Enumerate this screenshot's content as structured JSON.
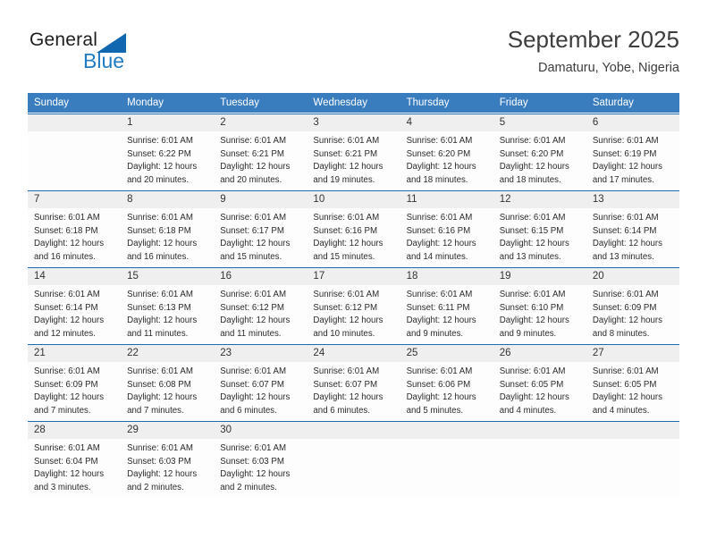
{
  "brand": {
    "name_part1": "General",
    "name_part2": "Blue",
    "triangle_color": "#1168b0",
    "blue_color": "#1f7cc4"
  },
  "header": {
    "title": "September 2025",
    "subtitle": "Damaturu, Yobe, Nigeria"
  },
  "theme": {
    "header_row_bg": "#3a7dbf",
    "date_band_bg": "#efefef",
    "week_rule": "#1e6cb0",
    "cell_bg": "#fdfdfd"
  },
  "calendar": {
    "weekday_headers": [
      "Sunday",
      "Monday",
      "Tuesday",
      "Wednesday",
      "Thursday",
      "Friday",
      "Saturday"
    ],
    "weeks": [
      [
        {
          "day": "",
          "sunrise": "",
          "sunset": "",
          "daylight1": "",
          "daylight2": "",
          "empty": true
        },
        {
          "day": "1",
          "sunrise": "Sunrise: 6:01 AM",
          "sunset": "Sunset: 6:22 PM",
          "daylight1": "Daylight: 12 hours",
          "daylight2": "and 20 minutes."
        },
        {
          "day": "2",
          "sunrise": "Sunrise: 6:01 AM",
          "sunset": "Sunset: 6:21 PM",
          "daylight1": "Daylight: 12 hours",
          "daylight2": "and 20 minutes."
        },
        {
          "day": "3",
          "sunrise": "Sunrise: 6:01 AM",
          "sunset": "Sunset: 6:21 PM",
          "daylight1": "Daylight: 12 hours",
          "daylight2": "and 19 minutes."
        },
        {
          "day": "4",
          "sunrise": "Sunrise: 6:01 AM",
          "sunset": "Sunset: 6:20 PM",
          "daylight1": "Daylight: 12 hours",
          "daylight2": "and 18 minutes."
        },
        {
          "day": "5",
          "sunrise": "Sunrise: 6:01 AM",
          "sunset": "Sunset: 6:20 PM",
          "daylight1": "Daylight: 12 hours",
          "daylight2": "and 18 minutes."
        },
        {
          "day": "6",
          "sunrise": "Sunrise: 6:01 AM",
          "sunset": "Sunset: 6:19 PM",
          "daylight1": "Daylight: 12 hours",
          "daylight2": "and 17 minutes."
        }
      ],
      [
        {
          "day": "7",
          "sunrise": "Sunrise: 6:01 AM",
          "sunset": "Sunset: 6:18 PM",
          "daylight1": "Daylight: 12 hours",
          "daylight2": "and 16 minutes."
        },
        {
          "day": "8",
          "sunrise": "Sunrise: 6:01 AM",
          "sunset": "Sunset: 6:18 PM",
          "daylight1": "Daylight: 12 hours",
          "daylight2": "and 16 minutes."
        },
        {
          "day": "9",
          "sunrise": "Sunrise: 6:01 AM",
          "sunset": "Sunset: 6:17 PM",
          "daylight1": "Daylight: 12 hours",
          "daylight2": "and 15 minutes."
        },
        {
          "day": "10",
          "sunrise": "Sunrise: 6:01 AM",
          "sunset": "Sunset: 6:16 PM",
          "daylight1": "Daylight: 12 hours",
          "daylight2": "and 15 minutes."
        },
        {
          "day": "11",
          "sunrise": "Sunrise: 6:01 AM",
          "sunset": "Sunset: 6:16 PM",
          "daylight1": "Daylight: 12 hours",
          "daylight2": "and 14 minutes."
        },
        {
          "day": "12",
          "sunrise": "Sunrise: 6:01 AM",
          "sunset": "Sunset: 6:15 PM",
          "daylight1": "Daylight: 12 hours",
          "daylight2": "and 13 minutes."
        },
        {
          "day": "13",
          "sunrise": "Sunrise: 6:01 AM",
          "sunset": "Sunset: 6:14 PM",
          "daylight1": "Daylight: 12 hours",
          "daylight2": "and 13 minutes."
        }
      ],
      [
        {
          "day": "14",
          "sunrise": "Sunrise: 6:01 AM",
          "sunset": "Sunset: 6:14 PM",
          "daylight1": "Daylight: 12 hours",
          "daylight2": "and 12 minutes."
        },
        {
          "day": "15",
          "sunrise": "Sunrise: 6:01 AM",
          "sunset": "Sunset: 6:13 PM",
          "daylight1": "Daylight: 12 hours",
          "daylight2": "and 11 minutes."
        },
        {
          "day": "16",
          "sunrise": "Sunrise: 6:01 AM",
          "sunset": "Sunset: 6:12 PM",
          "daylight1": "Daylight: 12 hours",
          "daylight2": "and 11 minutes."
        },
        {
          "day": "17",
          "sunrise": "Sunrise: 6:01 AM",
          "sunset": "Sunset: 6:12 PM",
          "daylight1": "Daylight: 12 hours",
          "daylight2": "and 10 minutes."
        },
        {
          "day": "18",
          "sunrise": "Sunrise: 6:01 AM",
          "sunset": "Sunset: 6:11 PM",
          "daylight1": "Daylight: 12 hours",
          "daylight2": "and 9 minutes."
        },
        {
          "day": "19",
          "sunrise": "Sunrise: 6:01 AM",
          "sunset": "Sunset: 6:10 PM",
          "daylight1": "Daylight: 12 hours",
          "daylight2": "and 9 minutes."
        },
        {
          "day": "20",
          "sunrise": "Sunrise: 6:01 AM",
          "sunset": "Sunset: 6:09 PM",
          "daylight1": "Daylight: 12 hours",
          "daylight2": "and 8 minutes."
        }
      ],
      [
        {
          "day": "21",
          "sunrise": "Sunrise: 6:01 AM",
          "sunset": "Sunset: 6:09 PM",
          "daylight1": "Daylight: 12 hours",
          "daylight2": "and 7 minutes."
        },
        {
          "day": "22",
          "sunrise": "Sunrise: 6:01 AM",
          "sunset": "Sunset: 6:08 PM",
          "daylight1": "Daylight: 12 hours",
          "daylight2": "and 7 minutes."
        },
        {
          "day": "23",
          "sunrise": "Sunrise: 6:01 AM",
          "sunset": "Sunset: 6:07 PM",
          "daylight1": "Daylight: 12 hours",
          "daylight2": "and 6 minutes."
        },
        {
          "day": "24",
          "sunrise": "Sunrise: 6:01 AM",
          "sunset": "Sunset: 6:07 PM",
          "daylight1": "Daylight: 12 hours",
          "daylight2": "and 6 minutes."
        },
        {
          "day": "25",
          "sunrise": "Sunrise: 6:01 AM",
          "sunset": "Sunset: 6:06 PM",
          "daylight1": "Daylight: 12 hours",
          "daylight2": "and 5 minutes."
        },
        {
          "day": "26",
          "sunrise": "Sunrise: 6:01 AM",
          "sunset": "Sunset: 6:05 PM",
          "daylight1": "Daylight: 12 hours",
          "daylight2": "and 4 minutes."
        },
        {
          "day": "27",
          "sunrise": "Sunrise: 6:01 AM",
          "sunset": "Sunset: 6:05 PM",
          "daylight1": "Daylight: 12 hours",
          "daylight2": "and 4 minutes."
        }
      ],
      [
        {
          "day": "28",
          "sunrise": "Sunrise: 6:01 AM",
          "sunset": "Sunset: 6:04 PM",
          "daylight1": "Daylight: 12 hours",
          "daylight2": "and 3 minutes."
        },
        {
          "day": "29",
          "sunrise": "Sunrise: 6:01 AM",
          "sunset": "Sunset: 6:03 PM",
          "daylight1": "Daylight: 12 hours",
          "daylight2": "and 2 minutes."
        },
        {
          "day": "30",
          "sunrise": "Sunrise: 6:01 AM",
          "sunset": "Sunset: 6:03 PM",
          "daylight1": "Daylight: 12 hours",
          "daylight2": "and 2 minutes."
        },
        {
          "day": "",
          "sunrise": "",
          "sunset": "",
          "daylight1": "",
          "daylight2": "",
          "empty": true
        },
        {
          "day": "",
          "sunrise": "",
          "sunset": "",
          "daylight1": "",
          "daylight2": "",
          "empty": true
        },
        {
          "day": "",
          "sunrise": "",
          "sunset": "",
          "daylight1": "",
          "daylight2": "",
          "empty": true
        },
        {
          "day": "",
          "sunrise": "",
          "sunset": "",
          "daylight1": "",
          "daylight2": "",
          "empty": true
        }
      ]
    ]
  }
}
